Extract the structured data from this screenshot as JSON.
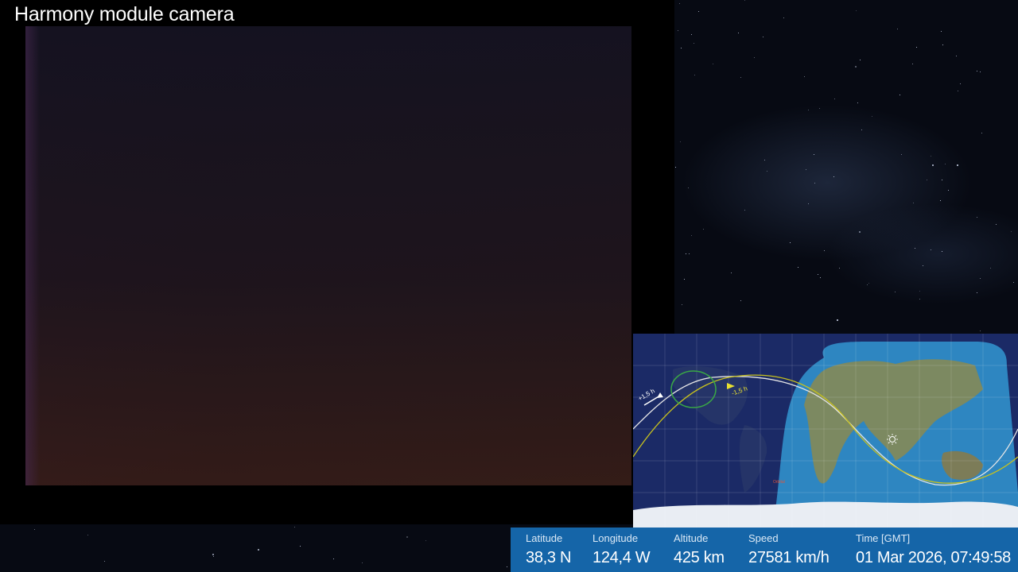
{
  "camera": {
    "title": "Harmony module camera"
  },
  "telemetry": {
    "latitude": {
      "label": "Latitude",
      "value": "38,3 N"
    },
    "longitude": {
      "label": "Longitude",
      "value": "124,4 W"
    },
    "altitude": {
      "label": "Altitude",
      "value": "425 km"
    },
    "speed": {
      "label": "Speed",
      "value": "27581 km/h"
    },
    "time": {
      "label": "Time [GMT]",
      "value": "01 Mar 2026, 07:49:58"
    }
  },
  "map": {
    "orbit_minus_label": "+1,5 h",
    "orbit_plus_label": "-1,5 h",
    "orbital_info": "Orbital",
    "sun_icon": "sun-icon",
    "colors": {
      "daylight": "#2e86c1",
      "night": "#1b2a66",
      "orbit_future": "#c7c11e",
      "orbit_past": "#e6e6e6",
      "position_circle": "#3aa845"
    }
  },
  "colors": {
    "info_bar": "#1565a8",
    "background": "#05070d"
  }
}
